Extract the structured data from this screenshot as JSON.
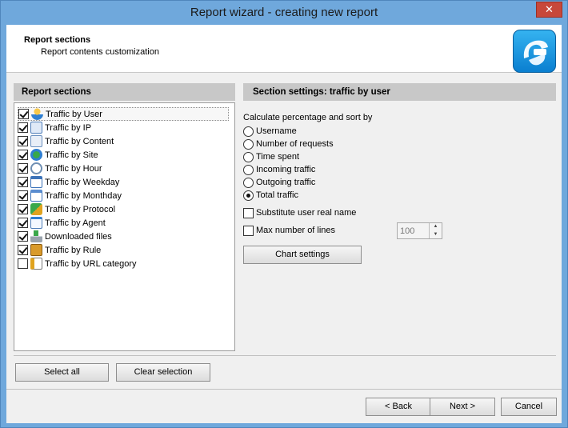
{
  "window": {
    "title": "Report wizard - creating new report",
    "close_glyph": "✕"
  },
  "header": {
    "title": "Report sections",
    "subtitle": "Report contents customization",
    "logo_icon": "app-logo-icon"
  },
  "left_panel": {
    "heading": "Report sections",
    "items": [
      {
        "label": "Traffic by User",
        "checked": true,
        "icon": "user-icon"
      },
      {
        "label": "Traffic by IP",
        "checked": true,
        "icon": "ip-icon"
      },
      {
        "label": "Traffic by Content",
        "checked": true,
        "icon": "content-icon"
      },
      {
        "label": "Traffic by Site",
        "checked": true,
        "icon": "globe-icon"
      },
      {
        "label": "Traffic by Hour",
        "checked": true,
        "icon": "clock-icon"
      },
      {
        "label": "Traffic by Weekday",
        "checked": true,
        "icon": "calendar-weekday-icon"
      },
      {
        "label": "Traffic by Monthday",
        "checked": true,
        "icon": "calendar-monthday-icon"
      },
      {
        "label": "Traffic by Protocol",
        "checked": true,
        "icon": "protocol-icon"
      },
      {
        "label": "Traffic by Agent",
        "checked": true,
        "icon": "window-agent-icon"
      },
      {
        "label": "Downloaded files",
        "checked": true,
        "icon": "download-icon"
      },
      {
        "label": "Traffic by Rule",
        "checked": true,
        "icon": "rule-icon"
      },
      {
        "label": "Traffic by URL category",
        "checked": false,
        "icon": "url-category-icon"
      }
    ],
    "select_all": "Select all",
    "clear_selection": "Clear selection"
  },
  "right_panel": {
    "heading": "Section settings: traffic by user",
    "sort_caption": "Calculate percentage and sort by",
    "sort_options": [
      {
        "label": "Username",
        "selected": false
      },
      {
        "label": "Number of requests",
        "selected": false
      },
      {
        "label": "Time spent",
        "selected": false
      },
      {
        "label": "Incoming traffic",
        "selected": false
      },
      {
        "label": "Outgoing traffic",
        "selected": false
      },
      {
        "label": "Total traffic",
        "selected": true
      }
    ],
    "substitute_real_name": {
      "label": "Substitute user real name",
      "checked": false
    },
    "max_lines": {
      "label": "Max number of lines",
      "checked": false,
      "value": "100"
    },
    "chart_settings": "Chart settings"
  },
  "footer": {
    "back": "< Back",
    "next": "Next >",
    "cancel": "Cancel"
  }
}
